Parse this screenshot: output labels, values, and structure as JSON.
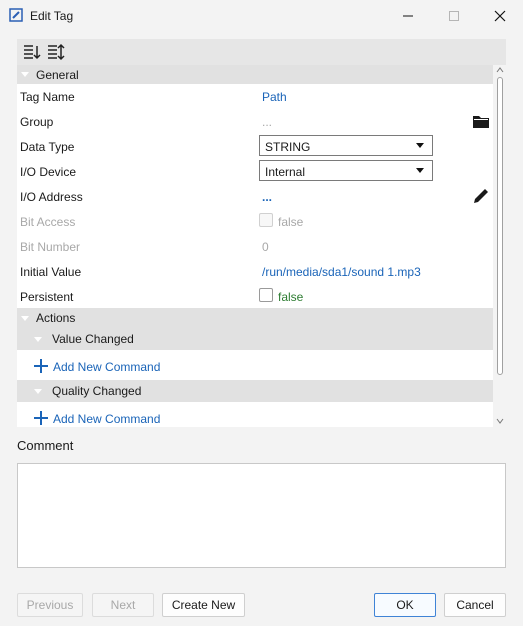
{
  "window": {
    "title": "Edit Tag"
  },
  "grid": {
    "category_general": "General",
    "rows": [
      {
        "label": "Tag Name",
        "value": "Path"
      },
      {
        "label": "Group",
        "value": "..."
      },
      {
        "label": "Data Type",
        "value": "STRING"
      },
      {
        "label": "I/O Device",
        "value": "Internal"
      },
      {
        "label": "I/O Address",
        "value": "..."
      },
      {
        "label": "Bit Access",
        "value": "false"
      },
      {
        "label": "Bit Number",
        "value": "0"
      },
      {
        "label": "Initial Value",
        "value": "/run/media/sda1/sound 1.mp3"
      },
      {
        "label": "Persistent",
        "value": "false"
      }
    ],
    "category_actions": "Actions",
    "value_changed": "Value Changed",
    "quality_changed": "Quality Changed",
    "add_command": "Add New Command"
  },
  "comment": {
    "label": "Comment",
    "value": ""
  },
  "buttons": {
    "previous": "Previous",
    "next": "Next",
    "create_new": "Create New",
    "ok": "OK",
    "cancel": "Cancel"
  },
  "colors": {
    "link": "#1a64b8",
    "green": "#2e7d32",
    "category": "#e1e1e1"
  },
  "icons": [
    "app-icon",
    "minimize-icon",
    "maximize-icon",
    "close-icon",
    "sort-desc-icon",
    "sort-category-icon",
    "folder-icon",
    "pencil-icon",
    "plus-icon"
  ]
}
